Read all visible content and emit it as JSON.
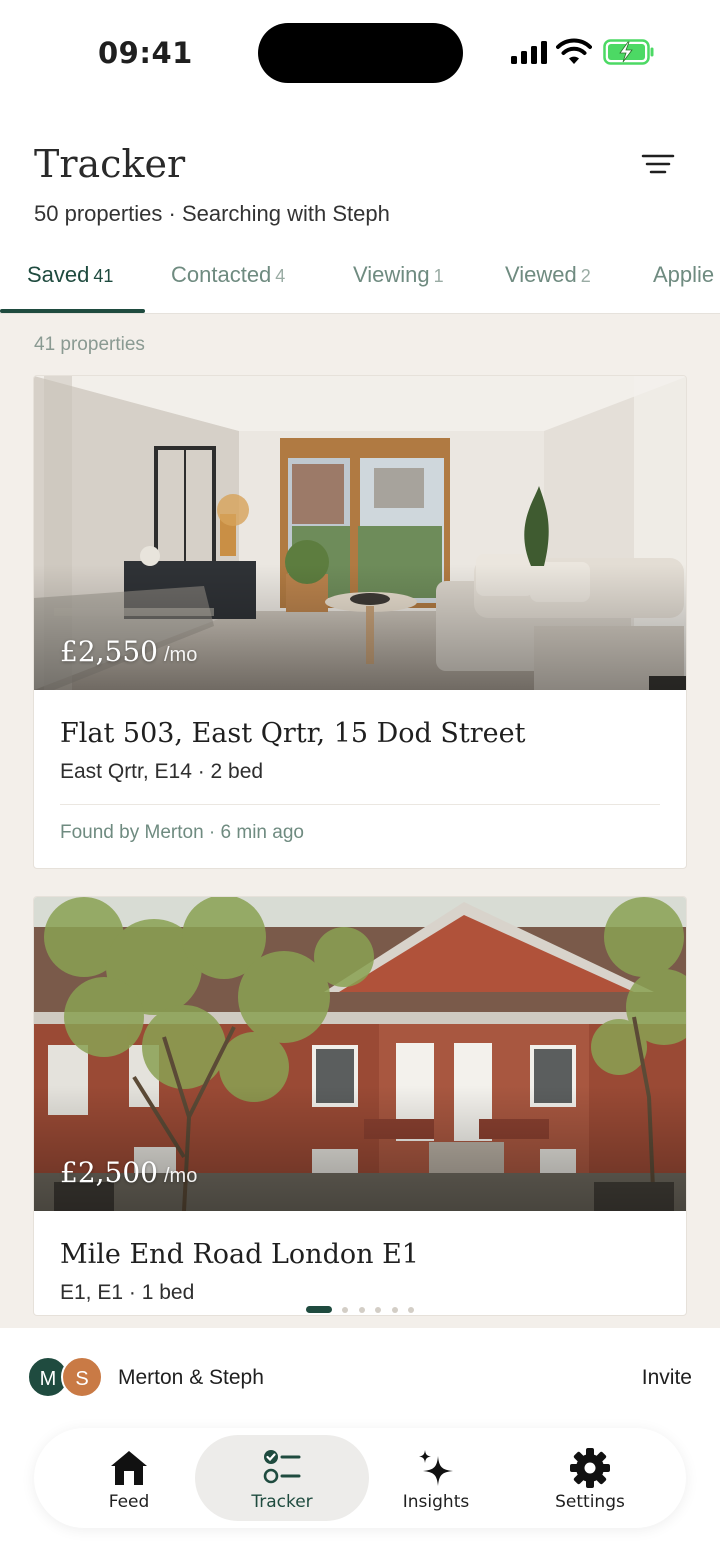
{
  "status_bar": {
    "time": "09:41"
  },
  "header": {
    "title": "Tracker",
    "subtitle": "50 properties · Searching with Steph"
  },
  "tabs": [
    {
      "label": "Saved",
      "count": "41",
      "active": true
    },
    {
      "label": "Contacted",
      "count": "4"
    },
    {
      "label": "Viewing",
      "count": "1"
    },
    {
      "label": "Viewed",
      "count": "2"
    },
    {
      "label": "Applie",
      "count": ""
    }
  ],
  "list": {
    "count_label": "41 properties",
    "properties": [
      {
        "price": "£2,550",
        "period": "/mo",
        "title": "Flat 503, East Qrtr, 15 Dod Street",
        "subtitle": "East Qrtr, E14 · 2 bed",
        "meta": "Found by Merton · 6 min ago"
      },
      {
        "price": "£2,500",
        "period": "/mo",
        "title": "Mile End Road London E1",
        "subtitle": "E1, E1 · 1 bed"
      }
    ],
    "page_indicator": {
      "pages": 6,
      "current": 1
    }
  },
  "share": {
    "avatars": [
      "M",
      "S"
    ],
    "members_label": "Merton & Steph",
    "invite_label": "Invite"
  },
  "nav": [
    {
      "label": "Feed",
      "icon": "home-icon"
    },
    {
      "label": "Tracker",
      "icon": "checklist-icon",
      "active": true
    },
    {
      "label": "Insights",
      "icon": "sparkle-icon"
    },
    {
      "label": "Settings",
      "icon": "gear-icon"
    }
  ],
  "colors": {
    "accent": "#1f4b3f",
    "background": "#f3efea",
    "muted_green": "#6f8b80",
    "avatar_s": "#c97a45"
  }
}
